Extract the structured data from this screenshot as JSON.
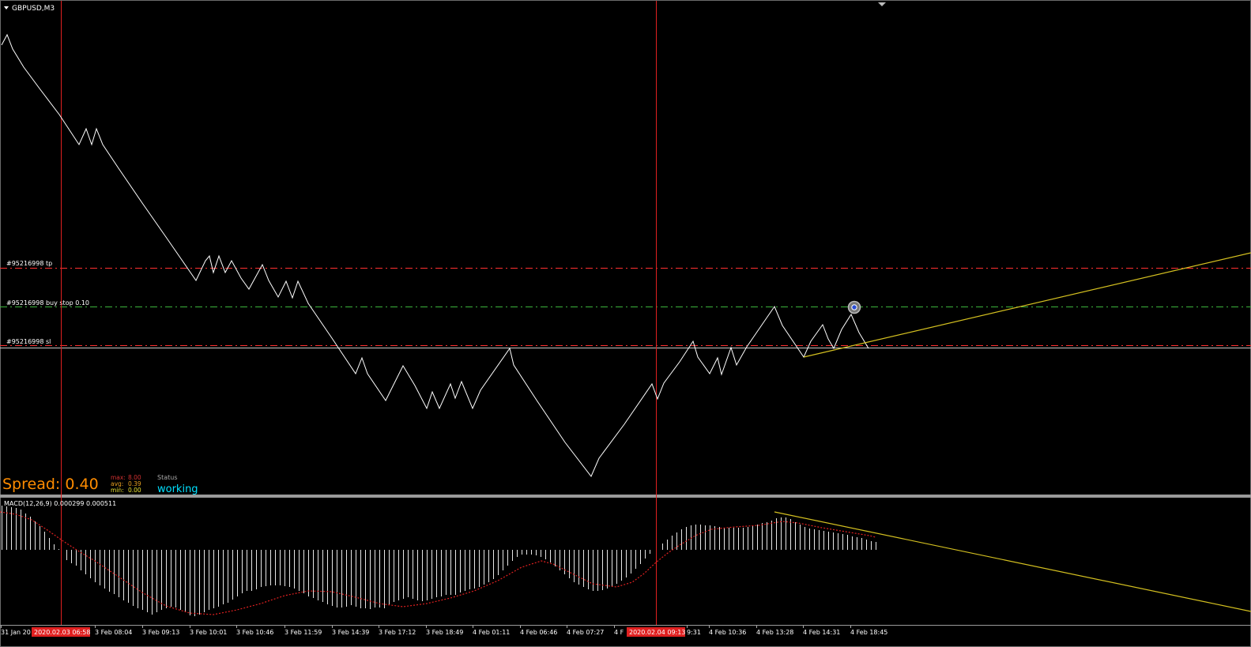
{
  "symbol": {
    "title": "GBPUSD,M3"
  },
  "orders": {
    "tp_label": "#95216998 tp",
    "buy_stop_label": "#95216998 buy stop 0.10",
    "sl_label": "#95216998 sl"
  },
  "spread": {
    "label": "Spread: 0.40",
    "max_label": "max:",
    "max": "8.00",
    "avg_label": "avg:",
    "avg": "0.39",
    "min_label": "min:",
    "min": "0.00",
    "status_label": "Status",
    "status_value": "working"
  },
  "indicator": {
    "title": "MACD(12,26,9) 0.000299 0.000511"
  },
  "time_axis": {
    "labels": [
      "31 Jan 20",
      "3 Feb 08:04",
      "3 Feb 09:13",
      "3 Feb 10:01",
      "3 Feb 10:46",
      "3 Feb 11:59",
      "3 Feb 14:39",
      "3 Feb 17:12",
      "3 Feb 18:49",
      "4 Feb 01:11",
      "4 Feb 06:46",
      "4 Feb 07:27",
      "4 F",
      "9:31",
      "4 Feb 10:36",
      "4 Feb 13:28",
      "4 Feb 14:31",
      "4 Feb 18:45"
    ],
    "crosshair_1": "2020.02.03 06:58",
    "crosshair_2": "2020.02.04 09:13"
  },
  "colors": {
    "background": "#000000",
    "price_line": "#ffffff",
    "tp_sl_line": "#ff3030",
    "buy_stop_line": "#3cb43c",
    "trendline": "#d4c020",
    "crosshair": "#e02020",
    "spread_text": "#ff8c00",
    "status_value": "#00e0ff",
    "signal_line": "#e02020"
  }
}
